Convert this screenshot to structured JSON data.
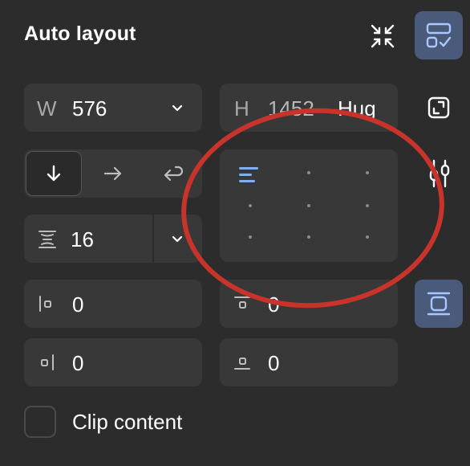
{
  "panel": {
    "title": "Auto layout",
    "collapse_icon": "minimize-arrows-icon",
    "suggest_icon": "layout-check-icon",
    "accent_bg": "#4a5a7a",
    "accent_fg": "#a9c7ff"
  },
  "width": {
    "label": "W",
    "value": "576",
    "dropdown_icon": "chevron-down-icon"
  },
  "height": {
    "label": "H",
    "value": "1452",
    "mode": "Hug"
  },
  "resize_icon": "resize-to-fit-icon",
  "direction": {
    "options": [
      "vertical",
      "horizontal",
      "wrap"
    ],
    "selected": "vertical"
  },
  "alignment": {
    "selected": "top-left",
    "indicator_color": "#7fb0f0"
  },
  "settings_icon": "sliders-icon",
  "gap": {
    "icon": "vertical-spacing-icon",
    "value": "16",
    "dropdown_icon": "chevron-down-icon"
  },
  "padding": {
    "left": "0",
    "top": "0",
    "right": "0",
    "bottom": "0"
  },
  "padding_mode_icon": "individual-padding-icon",
  "clip_content": {
    "label": "Clip content",
    "checked": false
  },
  "annotation": {
    "shape": "ellipse",
    "color": "#c8342b",
    "target": "alignment-grid"
  }
}
